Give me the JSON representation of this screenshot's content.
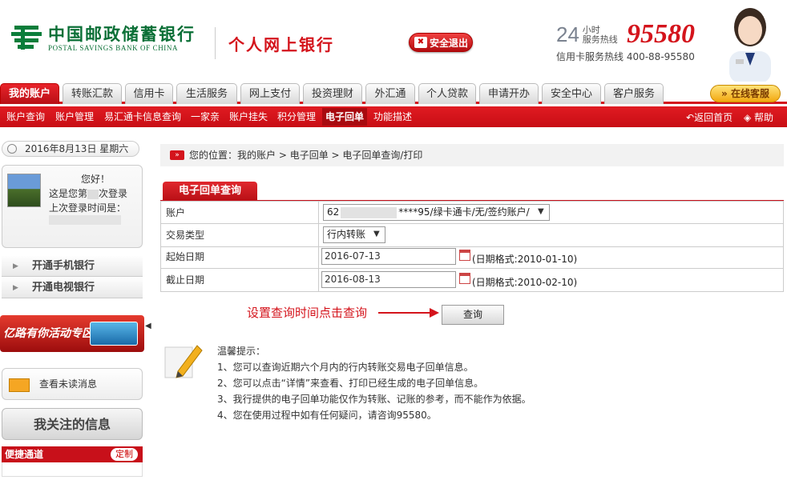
{
  "header": {
    "bank_name_cn": "中国邮政储蓄银行",
    "bank_name_en": "POSTAL SAVINGS BANK OF CHINA",
    "product": "个人网上银行",
    "logout_label": "安全退出",
    "hotline_24": "24",
    "hotline_sub1": "小时",
    "hotline_sub2": "服务热线",
    "hotline_number": "95580",
    "card_hotline": "信用卡服务热线  400-88-95580"
  },
  "nav": {
    "tabs": [
      {
        "label": "我的账户",
        "active": true
      },
      {
        "label": "转账汇款"
      },
      {
        "label": "信用卡"
      },
      {
        "label": "生活服务"
      },
      {
        "label": "网上支付"
      },
      {
        "label": "投资理财"
      },
      {
        "label": "外汇通"
      },
      {
        "label": "个人贷款"
      },
      {
        "label": "申请开办"
      },
      {
        "label": "安全中心"
      },
      {
        "label": "客户服务"
      }
    ],
    "online_service": "在线客服"
  },
  "subnav": {
    "items": [
      "账户查询",
      "账户管理",
      "易汇通卡信息查询",
      "一家亲",
      "账户挂失",
      "积分管理",
      "电子回单",
      "功能描述"
    ],
    "back_home": "返回首页",
    "help": "帮助"
  },
  "sidebar": {
    "date": "2016年8月13日 星期六",
    "hello": "您好！",
    "login_prefix": "这是您第",
    "login_suffix": "次登录",
    "last_login": "上次登录时间是：",
    "items": [
      "开通手机银行",
      "开通电视银行"
    ],
    "promo": "亿路有你活动专区",
    "unread": "查看未读消息",
    "focus": "我关注的信息",
    "quick": "便捷通道",
    "customize": "定制"
  },
  "breadcrumb": {
    "prefix": "您的位置：",
    "path": "我的账户 > 电子回单 > 电子回单查询/打印"
  },
  "form": {
    "title": "电子回单查询",
    "account_label": "账户",
    "account_prefix": "62",
    "account_suffix": "****95/绿卡通卡/无/签约账户/",
    "type_label": "交易类型",
    "type_value": "行内转账",
    "start_label": "起始日期",
    "start_value": "2016-07-13",
    "start_fmt": "(日期格式:2010-01-10)",
    "end_label": "截止日期",
    "end_value": "2016-08-13",
    "end_fmt": "(日期格式:2010-02-10)",
    "annotation": "设置查询时间点击查询",
    "query_button": "查询"
  },
  "tips": {
    "title": "温馨提示：",
    "lines": [
      "1、您可以查询近期六个月内的行内转账交易电子回单信息。",
      "2、您可以点击“详情”来查看、打印已经生成的电子回单信息。",
      "3、我行提供的电子回单功能仅作为转账、记账的参考，而不能作为依据。",
      "4、您在使用过程中如有任何疑问，请咨询95580。"
    ]
  },
  "colors": {
    "brand_red": "#d4141c",
    "brand_green": "#0a6f36"
  }
}
